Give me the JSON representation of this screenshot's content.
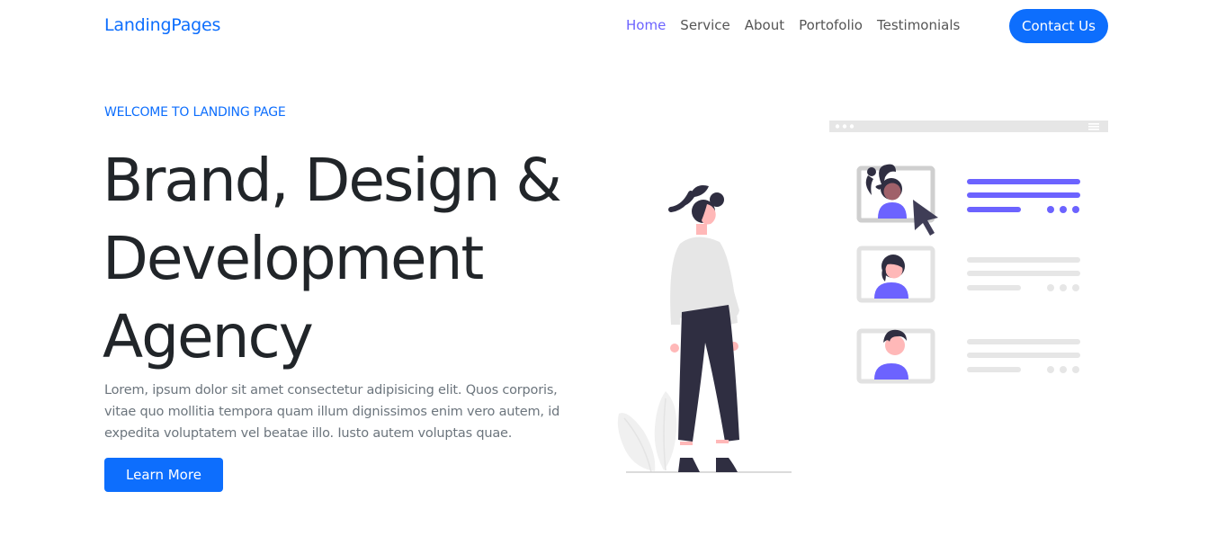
{
  "nav": {
    "brand": "LandingPages",
    "links": [
      "Home",
      "Service",
      "About",
      "Portofolio",
      "Testimonials"
    ],
    "active": "Home",
    "contact_label": "Contact Us"
  },
  "hero": {
    "eyebrow": "WELCOME TO LANDING PAGE",
    "headline_lines": [
      "Brand, Design &",
      "Development",
      "Agency"
    ],
    "lead": "Lorem, ipsum dolor sit amet consectetur adipisicing elit. Quos corporis, vitae quo mollitia tempora quam illum dignissimos enim vero autem, id expedita voluptatem vel beatae illo. Iusto autem voluptas quae.",
    "cta_label": "Learn More"
  },
  "colors": {
    "primary": "#0d6efd",
    "accent": "#6c63ff",
    "dark": "#2f2e41",
    "muted": "#6c757d",
    "light_gray": "#e6e6e6"
  },
  "illustration": {
    "icons": [
      "woman-standing-figure",
      "profile-card-woman-ponytail",
      "profile-card-woman-short-hair",
      "profile-card-man",
      "mouse-pointer-icon",
      "leaf-plant-icon"
    ]
  }
}
